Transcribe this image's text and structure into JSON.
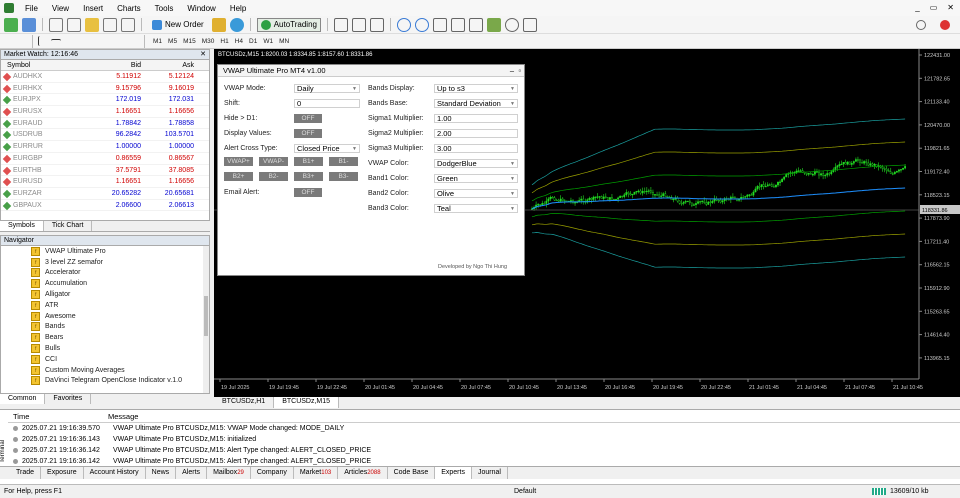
{
  "menu": {
    "items": [
      "File",
      "View",
      "Insert",
      "Charts",
      "Tools",
      "Window",
      "Help"
    ]
  },
  "toolbar": {
    "new_order": "New Order",
    "autotrading": "AutoTrading"
  },
  "timeframes": [
    "M1",
    "M5",
    "M15",
    "M30",
    "H1",
    "H4",
    "D1",
    "W1",
    "MN"
  ],
  "market_watch": {
    "title": "Market Watch: 12:16:46",
    "col_symbol": "Symbol",
    "col_bid": "Bid",
    "col_ask": "Ask",
    "rows": [
      {
        "symbol": "AUDHKX",
        "bid": "5.11912",
        "ask": "5.12124",
        "color": "#d00000"
      },
      {
        "symbol": "EURHKX",
        "bid": "9.15796",
        "ask": "9.16019",
        "color": "#d00000"
      },
      {
        "symbol": "EURJPX",
        "bid": "172.019",
        "ask": "172.031",
        "color": "#0000d0"
      },
      {
        "symbol": "EURUSX",
        "bid": "1.16651",
        "ask": "1.16656",
        "color": "#d00000"
      },
      {
        "symbol": "EURAUD",
        "bid": "1.78842",
        "ask": "1.78858",
        "color": "#0000d0"
      },
      {
        "symbol": "USDRUB",
        "bid": "96.2842",
        "ask": "103.5701",
        "color": "#0000d0"
      },
      {
        "symbol": "EURRUR",
        "bid": "1.00000",
        "ask": "1.00000",
        "color": "#0000d0"
      },
      {
        "symbol": "EURGBP",
        "bid": "0.86559",
        "ask": "0.86567",
        "color": "#d00000"
      },
      {
        "symbol": "EURTHB",
        "bid": "37.5791",
        "ask": "37.8085",
        "color": "#d00000"
      },
      {
        "symbol": "EURUSD",
        "bid": "1.16651",
        "ask": "1.16656",
        "color": "#d00000"
      },
      {
        "symbol": "EURZAR",
        "bid": "20.65282",
        "ask": "20.65681",
        "color": "#0000d0"
      },
      {
        "symbol": "GBPAUX",
        "bid": "2.06600",
        "ask": "2.06613",
        "color": "#0000d0"
      }
    ],
    "tabs": [
      "Symbols",
      "Tick Chart"
    ]
  },
  "navigator": {
    "title": "Navigator",
    "items": [
      "VWAP Ultimate Pro",
      "3 level ZZ semafor",
      "Accelerator",
      "Accumulation",
      "Alligator",
      "ATR",
      "Awesome",
      "Bands",
      "Bears",
      "Bulls",
      "CCI",
      "Custom Moving Averages",
      "DaVinci Telegram OpenClose Indicator v.1.0"
    ],
    "tabs": [
      "Common",
      "Favorites"
    ]
  },
  "chart": {
    "header": "BTCUSDz,M15  1:8200.03 1:8334.85 1:8157.60 1:8331.86",
    "price_labels": [
      "122431.00",
      "121782.65",
      "121133.40",
      "120470.00",
      "119821.65",
      "119172.40",
      "118523.15",
      "117873.90",
      "117211.40",
      "116562.15",
      "115912.90",
      "115263.65",
      "114614.40",
      "113965.15"
    ],
    "current_price": "118331.86",
    "time_labels": [
      "19 Jul 2025",
      "19 Jul 19:45",
      "19 Jul 22:45",
      "20 Jul 01:45",
      "20 Jul 04:45",
      "20 Jul 07:45",
      "20 Jul 10:45",
      "20 Jul 13:45",
      "20 Jul 16:45",
      "20 Jul 19:45",
      "20 Jul 22:45",
      "21 Jul 01:45",
      "21 Jul 04:45",
      "21 Jul 07:45",
      "21 Jul 10:45"
    ],
    "tabs": [
      "BTCUSDz,H1",
      "BTCUSDz,M15"
    ]
  },
  "dialog": {
    "title": "VWAP Ultimate Pro MT4 v1.00",
    "left": [
      {
        "label": "VWAP Mode:",
        "value": "Daily",
        "kind": "select"
      },
      {
        "label": "Shift:",
        "value": "0",
        "kind": "input"
      },
      {
        "label": "Hide > D1:",
        "value": "OFF",
        "kind": "toggle"
      },
      {
        "label": "Display Values:",
        "value": "OFF",
        "kind": "toggle"
      },
      {
        "label": "Alert Cross Type:",
        "value": "Closed Price",
        "kind": "select"
      }
    ],
    "buttons_row1": [
      "VWAP+",
      "VWAP-",
      "B1+",
      "B1-"
    ],
    "buttons_row2": [
      "B2+",
      "B2-",
      "B3+",
      "B3-"
    ],
    "email_label": "Email Alert:",
    "email_value": "OFF",
    "right": [
      {
        "label": "Bands Display:",
        "value": "Up to s3",
        "kind": "select"
      },
      {
        "label": "Bands Base:",
        "value": "Standard Deviation",
        "kind": "select"
      },
      {
        "label": "Sigma1 Multiplier:",
        "value": "1.00",
        "kind": "input"
      },
      {
        "label": "Sigma2 Multiplier:",
        "value": "2.00",
        "kind": "input"
      },
      {
        "label": "Sigma3 Multiplier:",
        "value": "3.00",
        "kind": "input"
      },
      {
        "label": "VWAP Color:",
        "value": "DodgerBlue",
        "kind": "select"
      },
      {
        "label": "Band1 Color:",
        "value": "Green",
        "kind": "select"
      },
      {
        "label": "Band2 Color:",
        "value": "Olive",
        "kind": "select"
      },
      {
        "label": "Band3 Color:",
        "value": "Teal",
        "kind": "select"
      }
    ],
    "footer": "Developed by Ngo Thi Hung"
  },
  "terminal": {
    "col_time": "Time",
    "col_message": "Message",
    "rows": [
      {
        "time": "2025.07.21 19:16:39.570",
        "message": "VWAP Ultimate Pro BTCUSDz,M15: VWAP Mode changed: MODE_DAILY"
      },
      {
        "time": "2025.07.21 19:16:36.143",
        "message": "VWAP Ultimate Pro BTCUSDz,M15: initialized"
      },
      {
        "time": "2025.07.21 19:16:36.142",
        "message": "VWAP Ultimate Pro BTCUSDz,M15: Alert Type changed: ALERT_CLOSED_PRICE"
      },
      {
        "time": "2025.07.21 19:16:36.142",
        "message": "VWAP Ultimate Pro BTCUSDz,M15: Alert Type changed: ALERT_CLOSED_PRICE"
      }
    ],
    "side_label": "Terminal",
    "tabs": [
      {
        "label": "Trade",
        "badge": ""
      },
      {
        "label": "Exposure",
        "badge": ""
      },
      {
        "label": "Account History",
        "badge": ""
      },
      {
        "label": "News",
        "badge": ""
      },
      {
        "label": "Alerts",
        "badge": ""
      },
      {
        "label": "Mailbox",
        "badge": "29"
      },
      {
        "label": "Company",
        "badge": ""
      },
      {
        "label": "Market",
        "badge": "103"
      },
      {
        "label": "Articles",
        "badge": "2088"
      },
      {
        "label": "Code Base",
        "badge": ""
      },
      {
        "label": "Experts",
        "badge": ""
      },
      {
        "label": "Journal",
        "badge": ""
      }
    ]
  },
  "status": {
    "help": "For Help, press F1",
    "profile": "Default",
    "traffic": "13609/10 kb"
  },
  "colors": {
    "vwap": "#1e90ff",
    "band1": "#00a000",
    "band2": "#9aa000",
    "band3": "#1aa0a0",
    "candle": "#22dd22",
    "gridline": "#7f7f7f"
  }
}
